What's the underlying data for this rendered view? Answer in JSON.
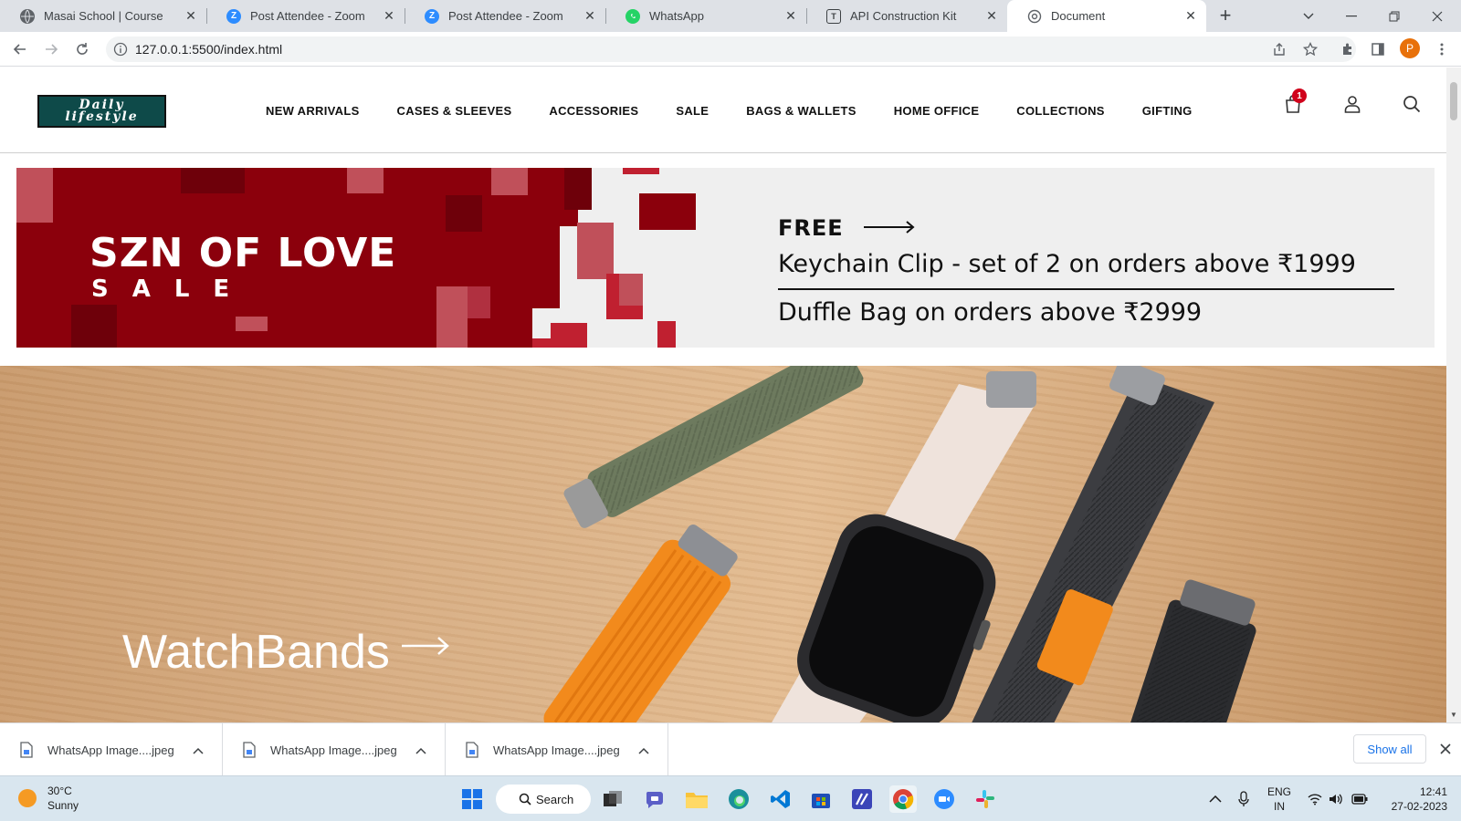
{
  "browser": {
    "tabs": [
      {
        "title": "Masai School | Course",
        "icon": "globe-icon"
      },
      {
        "title": "Post Attendee - Zoom",
        "icon": "zoom-icon"
      },
      {
        "title": "Post Attendee - Zoom",
        "icon": "zoom-icon"
      },
      {
        "title": "WhatsApp",
        "icon": "whatsapp-icon"
      },
      {
        "title": "API Construction Kit",
        "icon": "api-kit-icon"
      },
      {
        "title": "Document",
        "icon": "globe-icon"
      }
    ],
    "active_tab": 5,
    "url": "127.0.0.1:5500/index.html",
    "profile_initial": "P"
  },
  "site": {
    "logo_line1": "Daily",
    "logo_line2": "lifestyle",
    "nav": [
      "NEW ARRIVALS",
      "CASES & SLEEVES",
      "ACCESSORIES",
      "SALE",
      "BAGS & WALLETS",
      "HOME OFFICE",
      "COLLECTIONS",
      "GIFTING"
    ],
    "cart_count": "1"
  },
  "promo": {
    "title": "SZN OF LOVE",
    "subtitle": "SALE",
    "free_label": "FREE",
    "offer1": "Keychain Clip - set of 2 on orders above ₹1999",
    "offer2": "Duffle Bag on orders above ₹2999",
    "colors": {
      "red": "#8b000c",
      "pink": "#c0505a",
      "bg": "#efefef"
    }
  },
  "hero": {
    "title": "WatchBands"
  },
  "downloads": {
    "items": [
      "WhatsApp Image....jpeg",
      "WhatsApp Image....jpeg",
      "WhatsApp Image....jpeg"
    ],
    "show_all": "Show all"
  },
  "taskbar": {
    "weather_temp": "30°C",
    "weather_desc": "Sunny",
    "search_label": "Search",
    "lang_line1": "ENG",
    "lang_line2": "IN",
    "time": "12:41",
    "date": "27-02-2023"
  }
}
